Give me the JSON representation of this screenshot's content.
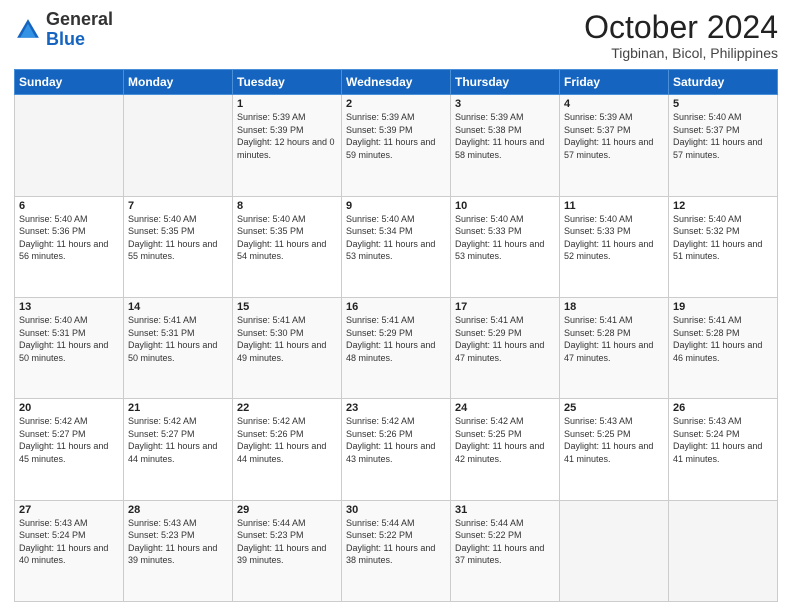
{
  "header": {
    "logo_general": "General",
    "logo_blue": "Blue",
    "month_title": "October 2024",
    "location": "Tigbinan, Bicol, Philippines"
  },
  "weekdays": [
    "Sunday",
    "Monday",
    "Tuesday",
    "Wednesday",
    "Thursday",
    "Friday",
    "Saturday"
  ],
  "weeks": [
    [
      {
        "day": "",
        "info": ""
      },
      {
        "day": "",
        "info": ""
      },
      {
        "day": "1",
        "info": "Sunrise: 5:39 AM\nSunset: 5:39 PM\nDaylight: 12 hours\nand 0 minutes."
      },
      {
        "day": "2",
        "info": "Sunrise: 5:39 AM\nSunset: 5:39 PM\nDaylight: 11 hours\nand 59 minutes."
      },
      {
        "day": "3",
        "info": "Sunrise: 5:39 AM\nSunset: 5:38 PM\nDaylight: 11 hours\nand 58 minutes."
      },
      {
        "day": "4",
        "info": "Sunrise: 5:39 AM\nSunset: 5:37 PM\nDaylight: 11 hours\nand 57 minutes."
      },
      {
        "day": "5",
        "info": "Sunrise: 5:40 AM\nSunset: 5:37 PM\nDaylight: 11 hours\nand 57 minutes."
      }
    ],
    [
      {
        "day": "6",
        "info": "Sunrise: 5:40 AM\nSunset: 5:36 PM\nDaylight: 11 hours\nand 56 minutes."
      },
      {
        "day": "7",
        "info": "Sunrise: 5:40 AM\nSunset: 5:35 PM\nDaylight: 11 hours\nand 55 minutes."
      },
      {
        "day": "8",
        "info": "Sunrise: 5:40 AM\nSunset: 5:35 PM\nDaylight: 11 hours\nand 54 minutes."
      },
      {
        "day": "9",
        "info": "Sunrise: 5:40 AM\nSunset: 5:34 PM\nDaylight: 11 hours\nand 53 minutes."
      },
      {
        "day": "10",
        "info": "Sunrise: 5:40 AM\nSunset: 5:33 PM\nDaylight: 11 hours\nand 53 minutes."
      },
      {
        "day": "11",
        "info": "Sunrise: 5:40 AM\nSunset: 5:33 PM\nDaylight: 11 hours\nand 52 minutes."
      },
      {
        "day": "12",
        "info": "Sunrise: 5:40 AM\nSunset: 5:32 PM\nDaylight: 11 hours\nand 51 minutes."
      }
    ],
    [
      {
        "day": "13",
        "info": "Sunrise: 5:40 AM\nSunset: 5:31 PM\nDaylight: 11 hours\nand 50 minutes."
      },
      {
        "day": "14",
        "info": "Sunrise: 5:41 AM\nSunset: 5:31 PM\nDaylight: 11 hours\nand 50 minutes."
      },
      {
        "day": "15",
        "info": "Sunrise: 5:41 AM\nSunset: 5:30 PM\nDaylight: 11 hours\nand 49 minutes."
      },
      {
        "day": "16",
        "info": "Sunrise: 5:41 AM\nSunset: 5:29 PM\nDaylight: 11 hours\nand 48 minutes."
      },
      {
        "day": "17",
        "info": "Sunrise: 5:41 AM\nSunset: 5:29 PM\nDaylight: 11 hours\nand 47 minutes."
      },
      {
        "day": "18",
        "info": "Sunrise: 5:41 AM\nSunset: 5:28 PM\nDaylight: 11 hours\nand 47 minutes."
      },
      {
        "day": "19",
        "info": "Sunrise: 5:41 AM\nSunset: 5:28 PM\nDaylight: 11 hours\nand 46 minutes."
      }
    ],
    [
      {
        "day": "20",
        "info": "Sunrise: 5:42 AM\nSunset: 5:27 PM\nDaylight: 11 hours\nand 45 minutes."
      },
      {
        "day": "21",
        "info": "Sunrise: 5:42 AM\nSunset: 5:27 PM\nDaylight: 11 hours\nand 44 minutes."
      },
      {
        "day": "22",
        "info": "Sunrise: 5:42 AM\nSunset: 5:26 PM\nDaylight: 11 hours\nand 44 minutes."
      },
      {
        "day": "23",
        "info": "Sunrise: 5:42 AM\nSunset: 5:26 PM\nDaylight: 11 hours\nand 43 minutes."
      },
      {
        "day": "24",
        "info": "Sunrise: 5:42 AM\nSunset: 5:25 PM\nDaylight: 11 hours\nand 42 minutes."
      },
      {
        "day": "25",
        "info": "Sunrise: 5:43 AM\nSunset: 5:25 PM\nDaylight: 11 hours\nand 41 minutes."
      },
      {
        "day": "26",
        "info": "Sunrise: 5:43 AM\nSunset: 5:24 PM\nDaylight: 11 hours\nand 41 minutes."
      }
    ],
    [
      {
        "day": "27",
        "info": "Sunrise: 5:43 AM\nSunset: 5:24 PM\nDaylight: 11 hours\nand 40 minutes."
      },
      {
        "day": "28",
        "info": "Sunrise: 5:43 AM\nSunset: 5:23 PM\nDaylight: 11 hours\nand 39 minutes."
      },
      {
        "day": "29",
        "info": "Sunrise: 5:44 AM\nSunset: 5:23 PM\nDaylight: 11 hours\nand 39 minutes."
      },
      {
        "day": "30",
        "info": "Sunrise: 5:44 AM\nSunset: 5:22 PM\nDaylight: 11 hours\nand 38 minutes."
      },
      {
        "day": "31",
        "info": "Sunrise: 5:44 AM\nSunset: 5:22 PM\nDaylight: 11 hours\nand 37 minutes."
      },
      {
        "day": "",
        "info": ""
      },
      {
        "day": "",
        "info": ""
      }
    ]
  ]
}
